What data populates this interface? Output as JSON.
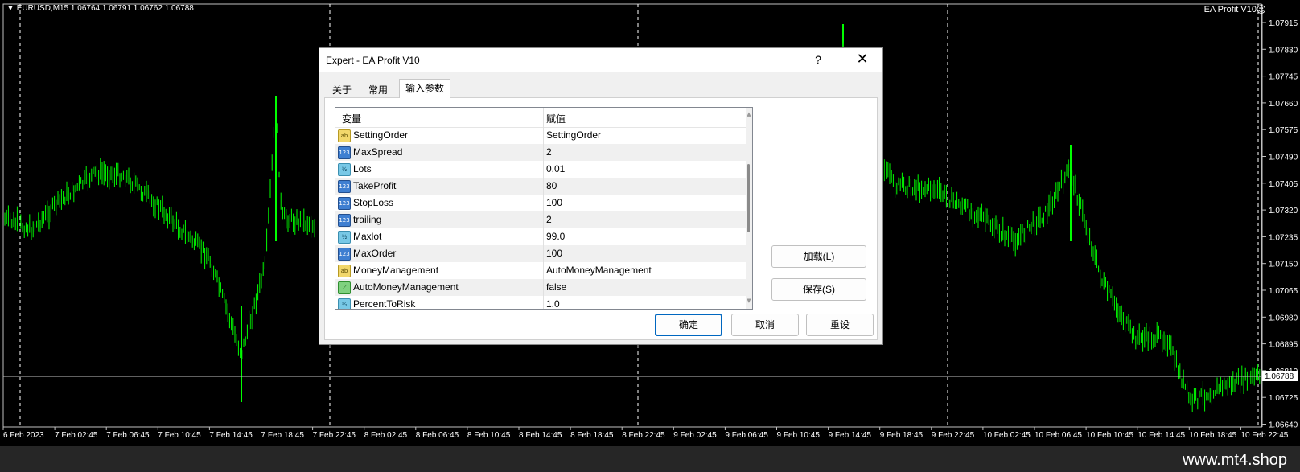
{
  "chart": {
    "symbol_info": "EURUSD,M15  1.06764 1.06791 1.06762 1.06788",
    "ea_label": "EA Profit V10",
    "ea_status_icon": "smiley-icon",
    "current_price": "1.06788",
    "price_axis": [
      "1.07915",
      "1.07830",
      "1.07745",
      "1.07660",
      "1.07575",
      "1.07490",
      "1.07405",
      "1.07320",
      "1.07235",
      "1.07150",
      "1.07065",
      "1.06980",
      "1.06895",
      "1.06810",
      "1.06725",
      "1.06640"
    ],
    "time_axis": [
      "6 Feb 2023",
      "7 Feb 02:45",
      "7 Feb 06:45",
      "7 Feb 10:45",
      "7 Feb 14:45",
      "7 Feb 18:45",
      "7 Feb 22:45",
      "8 Feb 02:45",
      "8 Feb 06:45",
      "8 Feb 10:45",
      "8 Feb 14:45",
      "8 Feb 18:45",
      "8 Feb 22:45",
      "9 Feb 02:45",
      "9 Feb 06:45",
      "9 Feb 10:45",
      "9 Feb 14:45",
      "9 Feb 18:45",
      "9 Feb 22:45",
      "10 Feb 02:45",
      "10 Feb 06:45",
      "10 Feb 10:45",
      "10 Feb 14:45",
      "10 Feb 18:45",
      "10 Feb 22:45"
    ],
    "colors": {
      "background": "#000000",
      "candles": "#00ff00",
      "grid": "#ffffff",
      "axis_text": "#ffffff"
    }
  },
  "watermark": "www.mt4.shop",
  "dialog": {
    "title": "Expert - EA Profit V10",
    "help_label": "?",
    "close_label": "✕",
    "tabs": [
      {
        "label": "关于",
        "active": false
      },
      {
        "label": "常用",
        "active": false
      },
      {
        "label": "输入参数",
        "active": true
      }
    ],
    "grid": {
      "col_variable": "变量",
      "col_value": "赋值",
      "rows": [
        {
          "icon": "ab",
          "name": "SettingOrder",
          "value": "SettingOrder"
        },
        {
          "icon": "123",
          "name": "MaxSpread",
          "value": "2"
        },
        {
          "icon": "½",
          "name": "Lots",
          "value": "0.01"
        },
        {
          "icon": "123",
          "name": "TakeProfit",
          "value": "80"
        },
        {
          "icon": "123",
          "name": "StopLoss",
          "value": "100"
        },
        {
          "icon": "123",
          "name": "trailing",
          "value": "2"
        },
        {
          "icon": "½",
          "name": "Maxlot",
          "value": "99.0"
        },
        {
          "icon": "123",
          "name": "MaxOrder",
          "value": "100"
        },
        {
          "icon": "ab",
          "name": "MoneyManagement",
          "value": "AutoMoneyManagement"
        },
        {
          "icon": "bool",
          "name": "AutoMoneyManagement",
          "value": "false"
        },
        {
          "icon": "½",
          "name": "PercentToRisk",
          "value": "1.0"
        }
      ]
    },
    "buttons": {
      "load": "加载(L)",
      "save": "保存(S)",
      "ok": "确定",
      "cancel": "取消",
      "reset": "重设"
    }
  }
}
